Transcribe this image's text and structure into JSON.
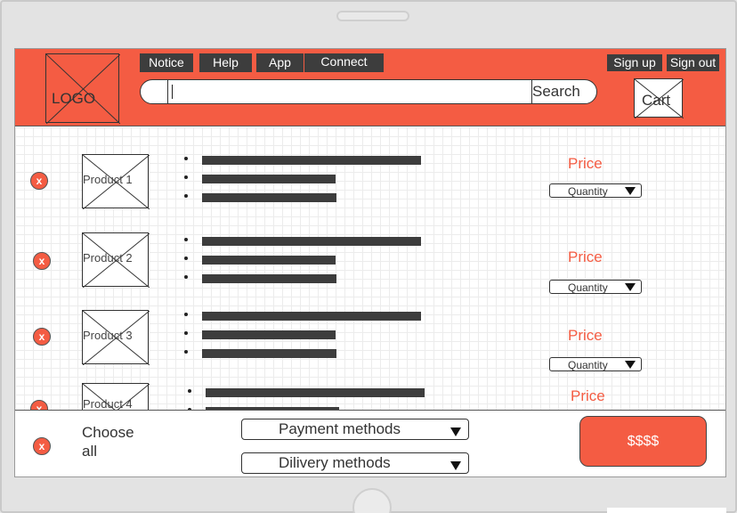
{
  "header": {
    "logo_text": "LOGO",
    "nav": [
      "Notice",
      "Help",
      "App",
      "Connect"
    ],
    "search_label": "Search",
    "sign_up": "Sign up",
    "sign_out": "Sign out",
    "cart_label": "Cart"
  },
  "remove_label": "x",
  "products": [
    {
      "name": "Product 1",
      "price": "Price",
      "quantity": "Quantity"
    },
    {
      "name": "Product 2",
      "price": "Price",
      "quantity": "Quantity"
    },
    {
      "name": "Product 3",
      "price": "Price",
      "quantity": "Quantity"
    },
    {
      "name": "Product 4",
      "price": "Price"
    }
  ],
  "footer": {
    "choose_all": "Choose all",
    "payment_methods": "Payment methods",
    "delivery_methods": "Dilivery methods",
    "pay_button": "$$$$"
  },
  "colors": {
    "accent": "#f45c43",
    "dark": "#3d3d3d"
  }
}
